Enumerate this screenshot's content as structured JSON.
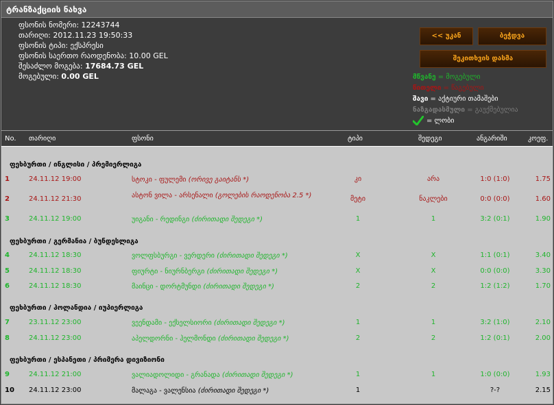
{
  "title": "ტრანზაქციის ნახვა",
  "info": [
    {
      "label": "ფსონის ნომერი:",
      "value": "12243744",
      "bold": false
    },
    {
      "label": "თარიღი:",
      "value": "2012.11.23 19:50:33",
      "bold": false
    },
    {
      "label": "ფსონის ტიპი:",
      "value": "ექსპრესი",
      "bold": false
    },
    {
      "label": "ფსონის საერთო რაოდენობა:",
      "value": "10.00 GEL",
      "bold": false
    },
    {
      "label": "შესაძლო მოგება:",
      "value": "17684.73 GEL",
      "bold": true
    },
    {
      "label": "მოგებული:",
      "value": "0.00 GEL",
      "bold": true
    }
  ],
  "buttons": {
    "back": "<< უკან",
    "print": "ბეჭდვა",
    "check": "შეკითხვის დასმა"
  },
  "legend": [
    {
      "key": "მწვანე",
      "eq": " = ",
      "desc": "მოგებული",
      "color": "#1fb52c"
    },
    {
      "key": "წითელი",
      "eq": " = ",
      "desc": "წაგებული",
      "color": "#a81515"
    },
    {
      "key": "შავი",
      "eq": " = ",
      "desc": "აქტიური თამაშები",
      "color": "#ffffff"
    },
    {
      "key": "ნაზგადასმული",
      "eq": " = ",
      "desc": "გაუქმებულია",
      "color": "#7a7a7a"
    }
  ],
  "legend_check": "= ლობი",
  "columns": {
    "no": "No.",
    "date": "თარიღი",
    "event": "ფსონი",
    "type": "ტიპი",
    "outcome": "შედეგი",
    "score": "ანგარიში",
    "odds": "კოეფ."
  },
  "groups": [
    {
      "league": "ფეხბურთი / ინგლისი / პრემიერლიგა",
      "rows": [
        {
          "no": "1",
          "date": "24.11.12 19:00",
          "event": "სტოკი - ფულემი",
          "note": "(ორივე გაიტანს *)",
          "type": "კი",
          "outcome": "არა",
          "score": "1:0 (1:0)",
          "odds": "1.75",
          "status": "lost"
        },
        {
          "no": "2",
          "date": "24.11.12 21:30",
          "event": "ასტონ ვილა - არსენალი",
          "note": "(გოლების რაოდენობა 2.5 *)",
          "type": "მეტი",
          "outcome": "ნაკლები",
          "score": "0:0 (0:0)",
          "odds": "1.60",
          "status": "lost"
        },
        {
          "no": "3",
          "date": "24.11.12 19:00",
          "event": "უიგანი - რედინგი",
          "note": "(ძირითადი შედეგი *)",
          "type": "1",
          "outcome": "1",
          "score": "3:2 (0:1)",
          "odds": "1.90",
          "status": "won"
        }
      ]
    },
    {
      "league": "ფეხბურთი / გერმანია / ბუნდესლიგა",
      "rows": [
        {
          "no": "4",
          "date": "24.11.12 18:30",
          "event": "ვოლფსბურგი - ვერდერი",
          "note": "(ძირითადი შედეგი *)",
          "type": "X",
          "outcome": "X",
          "score": "1:1 (0:1)",
          "odds": "3.40",
          "status": "won"
        },
        {
          "no": "5",
          "date": "24.11.12 18:30",
          "event": "ფიურტი - ნიურნბერგი",
          "note": "(ძირითადი შედეგი *)",
          "type": "X",
          "outcome": "X",
          "score": "0:0 (0:0)",
          "odds": "3.30",
          "status": "won"
        },
        {
          "no": "6",
          "date": "24.11.12 18:30",
          "event": "მაინცი - დორტმუნდი",
          "note": "(ძირითადი შედეგი *)",
          "type": "2",
          "outcome": "2",
          "score": "1:2 (1:2)",
          "odds": "1.70",
          "status": "won"
        }
      ]
    },
    {
      "league": "ფეხბურთი / ჰოლანდია / იუპიერლიგა",
      "rows": [
        {
          "no": "7",
          "date": "23.11.12 23:00",
          "event": "ვეენდამი - ექსელსიორი",
          "note": "(ძირითადი შედეგი *)",
          "type": "1",
          "outcome": "1",
          "score": "3:2 (1:0)",
          "odds": "2.10",
          "status": "won"
        },
        {
          "no": "8",
          "date": "24.11.12 23:00",
          "event": "აპელდორნი - ჰელმონდი",
          "note": "(ძირითადი შედეგი *)",
          "type": "2",
          "outcome": "2",
          "score": "1:2 (0:1)",
          "odds": "2.00",
          "status": "won"
        }
      ]
    },
    {
      "league": "ფეხბურთი / ესპანეთი / პრიმერა დივიზიონი",
      "rows": [
        {
          "no": "9",
          "date": "24.11.12 21:00",
          "event": "ვალიადოლიდი - გრანადა",
          "note": "(ძირითადი შედეგი *)",
          "type": "1",
          "outcome": "1",
          "score": "1:0 (0:0)",
          "odds": "1.93",
          "status": "won"
        },
        {
          "no": "10",
          "date": "24.11.12 23:00",
          "event": "მალაგა - ვალენსია",
          "note": "(ძირითადი შედეგი *)",
          "type": "1",
          "outcome": "",
          "score": "?-?",
          "odds": "2.15",
          "status": "active"
        }
      ]
    }
  ]
}
